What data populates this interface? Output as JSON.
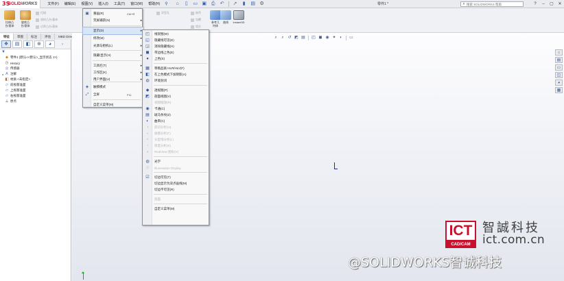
{
  "app": {
    "brand_prefix": "3S",
    "brand_name": "SOLID",
    "brand_suffix": "WORKS",
    "document_title": "零件1 *",
    "search_placeholder": "搜索 SOLIDWORKS 帮助"
  },
  "menubar": {
    "items": [
      "文件(F)",
      "编辑(E)",
      "视图(V)",
      "插入(I)",
      "工具(T)",
      "窗口(W)",
      "帮助(H)"
    ],
    "pin": "⚲"
  },
  "command_manager": {
    "big_buttons": [
      {
        "label": "拉伸凸\n台/基体"
      },
      {
        "label": "旋转凸\n台/基体"
      },
      {
        "label": "参考几\n何体"
      },
      {
        "label": "曲线"
      },
      {
        "label": "Instant3D"
      }
    ],
    "faint_rows": [
      "扫描",
      "放样凸台/基体",
      "边界凸台/基体"
    ],
    "faint_right": [
      "异型孔",
      "抽壳",
      "包覆",
      "相交"
    ]
  },
  "command_tabs": [
    "特征",
    "草图",
    "标注",
    "评估",
    "MBD Dimensions"
  ],
  "feature_tree": [
    {
      "toggle": "",
      "icon": "part",
      "label": "零件1 (默认<<默认>_显示状态 1>)"
    },
    {
      "toggle": "",
      "icon": "hist",
      "label": "History"
    },
    {
      "toggle": "",
      "icon": "sensor",
      "label": "传感器"
    },
    {
      "toggle": "▸",
      "icon": "annot",
      "label": "注解"
    },
    {
      "toggle": "",
      "icon": "mat",
      "label": "材质 <未指定>"
    },
    {
      "toggle": "",
      "icon": "plane",
      "label": "前视基准面"
    },
    {
      "toggle": "",
      "icon": "plane",
      "label": "上视基准面"
    },
    {
      "toggle": "",
      "icon": "plane",
      "label": "右视基准面"
    },
    {
      "toggle": "",
      "icon": "origin",
      "label": "原点"
    }
  ],
  "view_menu": [
    {
      "label": "重画(R)",
      "shortcut": "Ctrl+R",
      "icon": "▣",
      "arrow": ""
    },
    {
      "label": "荧屏捕获(N)",
      "shortcut": "",
      "icon": "",
      "arrow": "▸"
    },
    {
      "label": "显示(D)",
      "shortcut": "",
      "icon": "",
      "arrow": "▸"
    },
    {
      "label": "修改(M)",
      "shortcut": "",
      "icon": "",
      "arrow": "▸"
    },
    {
      "label": "光源与相机(L)",
      "shortcut": "",
      "icon": "",
      "arrow": "▸"
    },
    {
      "label": "隐藏/显示(H)",
      "shortcut": "",
      "icon": "",
      "arrow": "▸"
    },
    {
      "label": "工具栏(T)",
      "shortcut": "",
      "icon": "",
      "arrow": "▸"
    },
    {
      "label": "工作区(K)",
      "shortcut": "",
      "icon": "",
      "arrow": "▸"
    },
    {
      "label": "用户界面(U)",
      "shortcut": "",
      "icon": "",
      "arrow": "▸"
    },
    {
      "label": "触摸模式",
      "shortcut": "",
      "icon": "◈",
      "arrow": ""
    },
    {
      "label": "全屏",
      "shortcut": "F11",
      "icon": "⤢",
      "arrow": ""
    },
    {
      "label": "自定义菜单(M)",
      "shortcut": "",
      "icon": "",
      "arrow": ""
    }
  ],
  "display_menu": [
    {
      "label": "线架图(W)",
      "icon": "◰",
      "enabled": true
    },
    {
      "label": "隐藏线可见(D)",
      "icon": "◱",
      "enabled": true
    },
    {
      "label": "消除隐藏线(H)",
      "icon": "◲",
      "enabled": true
    },
    {
      "label": "带边线上色(E)",
      "icon": "◼",
      "enabled": true
    },
    {
      "label": "上色(S)",
      "icon": "●",
      "enabled": true
    },
    {
      "label": "草稿品质 HLR/HLV(F)",
      "icon": "▦",
      "enabled": true
    },
    {
      "label": "在上色模式下加阴影(A)",
      "icon": "◧",
      "enabled": true
    },
    {
      "label": "环境封闭",
      "icon": "◍",
      "enabled": true
    },
    {
      "label": "透视图(P)",
      "icon": "◆",
      "enabled": true
    },
    {
      "label": "剖面视图(V)",
      "icon": "◩",
      "enabled": true
    },
    {
      "label": "视图缩放(R)",
      "icon": "◌",
      "enabled": false
    },
    {
      "label": "卡通(C)",
      "icon": "◉",
      "enabled": true
    },
    {
      "label": "斑马条纹(Z)",
      "icon": "▤",
      "enabled": true
    },
    {
      "label": "曲率(C)",
      "icon": "◐",
      "enabled": true
    },
    {
      "label": "底切分析(U)",
      "icon": "◑",
      "enabled": false
    },
    {
      "label": "拔模分析(F)",
      "icon": "◒",
      "enabled": false
    },
    {
      "label": "分型线分析(L)",
      "icon": "◓",
      "enabled": false
    },
    {
      "label": "厚度分析(K)",
      "icon": "◔",
      "enabled": false
    },
    {
      "label": "RealView 图形(V)",
      "icon": "◕",
      "enabled": false
    },
    {
      "label": "光学",
      "icon": "◍",
      "enabled": true
    },
    {
      "label": "Illumination Display",
      "icon": "◎",
      "enabled": false
    },
    {
      "label": "切边可见(T)",
      "icon": "☑",
      "enabled": true
    },
    {
      "label": "切边显示为双点画线(M)",
      "icon": "",
      "enabled": true
    },
    {
      "label": "切边不可见(R)",
      "icon": "",
      "enabled": true
    },
    {
      "label": "剖面",
      "icon": "",
      "enabled": false
    },
    {
      "label": "自定义菜单(M)",
      "icon": "",
      "enabled": true
    }
  ],
  "watermark": {
    "badge_top": "ICT",
    "badge_bottom": "CAD/CAM",
    "company_cn": "智誠科技",
    "url": "ict.com.cn",
    "weibo": "@SOLIDWORKS智诚科技"
  }
}
